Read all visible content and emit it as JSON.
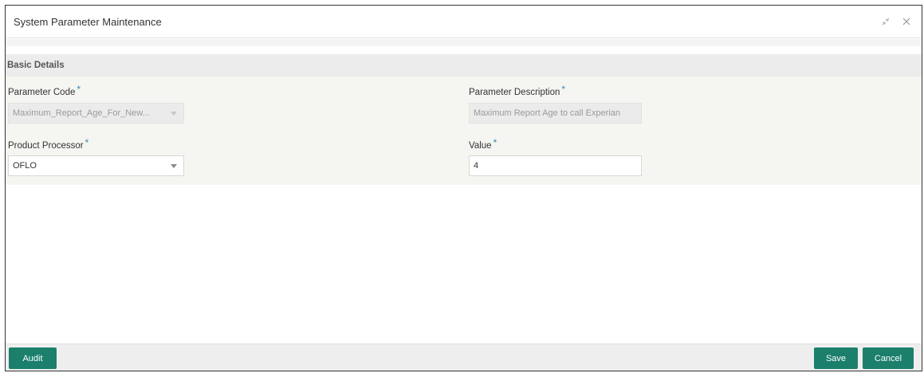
{
  "window": {
    "title": "System Parameter Maintenance",
    "controls": [
      "minimize-restore-icon",
      "close-icon"
    ]
  },
  "section": {
    "title": "Basic Details"
  },
  "fields": {
    "parameter_code": {
      "label": "Parameter Code",
      "required": "*",
      "value": "Maximum_Report_Age_For_New..."
    },
    "parameter_description": {
      "label": "Parameter Description",
      "required": "*",
      "value": "Maximum Report Age to call Experian"
    },
    "product_processor": {
      "label": "Product Processor",
      "required": "*",
      "value": "OFLO"
    },
    "value": {
      "label": "Value",
      "required": "*",
      "value": "4"
    }
  },
  "footer": {
    "audit_label": "Audit",
    "save_label": "Save",
    "cancel_label": "Cancel"
  },
  "colors": {
    "accent": "#1b7f6c",
    "required_star": "#2f8fb5"
  }
}
